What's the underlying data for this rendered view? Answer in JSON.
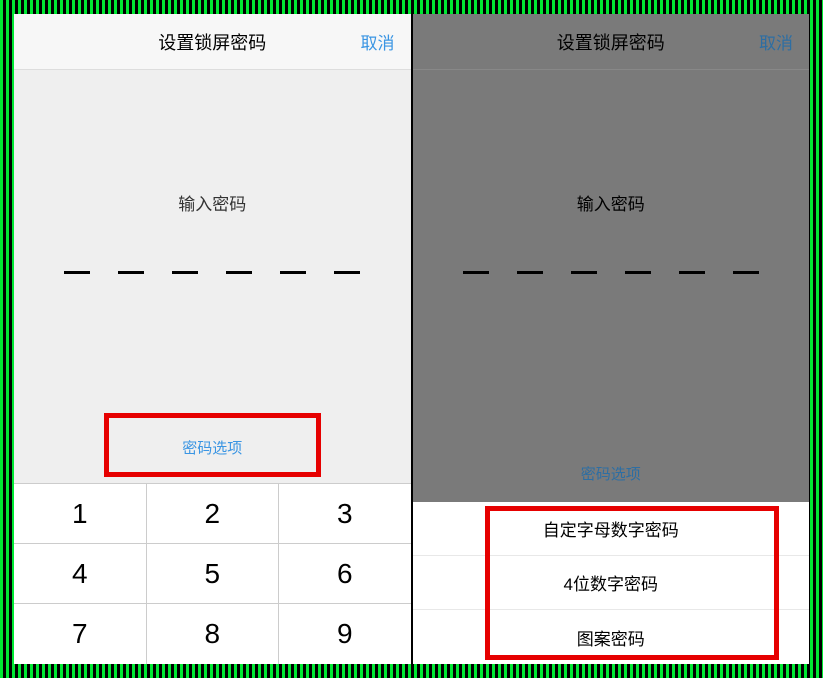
{
  "left": {
    "header": {
      "title": "设置锁屏密码",
      "cancel": "取消"
    },
    "prompt": "输入密码",
    "options_link": "密码选项",
    "keypad": {
      "rows": [
        [
          "1",
          "2",
          "3"
        ],
        [
          "4",
          "5",
          "6"
        ],
        [
          "7",
          "8",
          "9"
        ]
      ]
    }
  },
  "right": {
    "header": {
      "title": "设置锁屏密码",
      "cancel": "取消"
    },
    "prompt": "输入密码",
    "options_link": "密码选项",
    "popup": {
      "items": [
        "自定字母数字密码",
        "4位数字密码",
        "图案密码"
      ]
    }
  }
}
